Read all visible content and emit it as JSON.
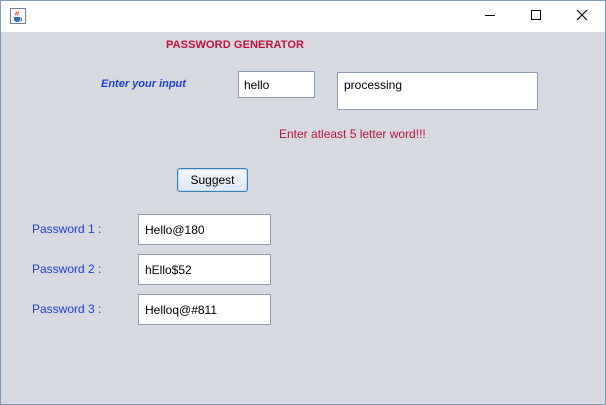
{
  "window": {
    "icon": "java-coffee-cup-icon",
    "controls": [
      "minimize-icon",
      "maximize-icon",
      "close-icon"
    ]
  },
  "header": {
    "title": "PASSWORD GENERATOR"
  },
  "input": {
    "label": "Enter your input",
    "value": "hello"
  },
  "status": {
    "value": "processing",
    "error": "Enter atleast 5 letter word!!!"
  },
  "actions": {
    "suggest_label": "Suggest"
  },
  "passwords": [
    {
      "label": "Password 1 :",
      "value": "Hello@180"
    },
    {
      "label": "Password 2 :",
      "value": "hEllo$52"
    },
    {
      "label": "Password 3 :",
      "value": "Helloq@#811"
    }
  ],
  "colors": {
    "heading": "#c0103c",
    "error": "#c0103c",
    "label_blue": "#1f3fd6",
    "panel_bg": "#d6d9df"
  }
}
